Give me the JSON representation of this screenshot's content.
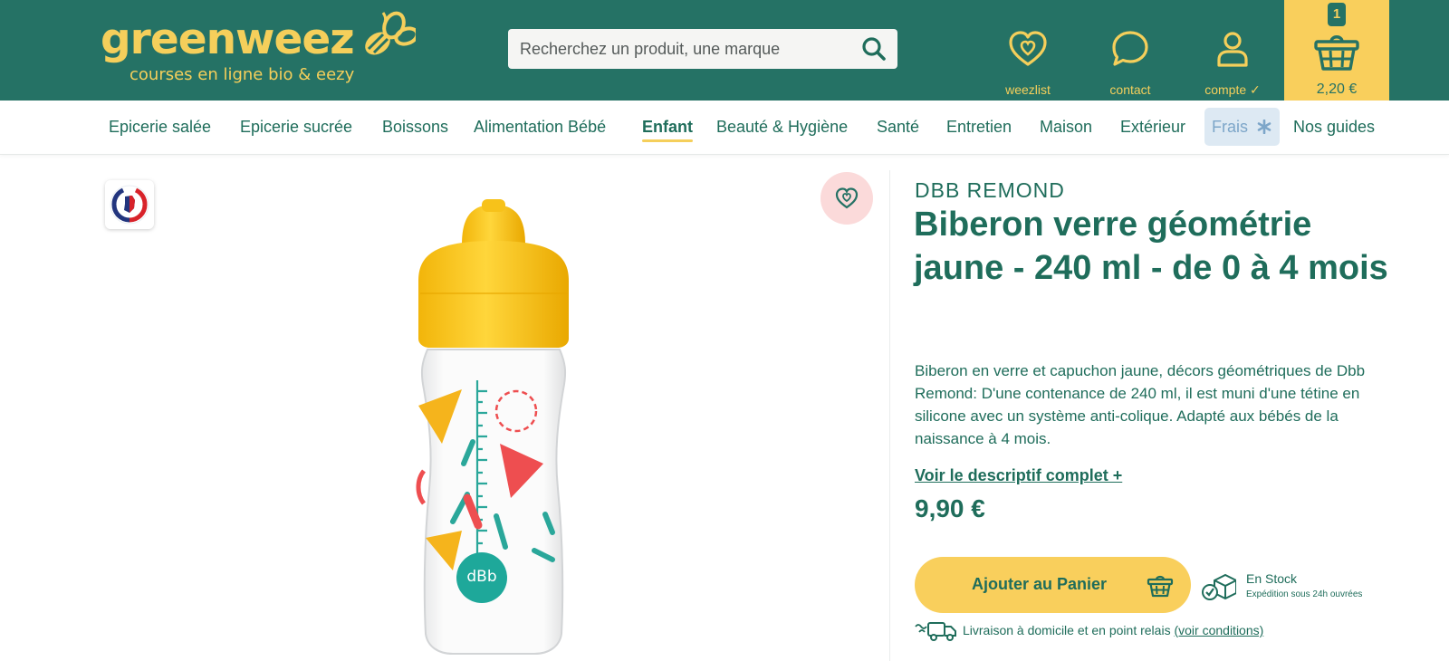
{
  "header": {
    "logo_word": "greenweez",
    "logo_tagline": "courses en ligne bio & eezy",
    "search_placeholder": "Recherchez un produit, une marque",
    "items": [
      {
        "label": "weezlist",
        "icon": "heart-icon"
      },
      {
        "label": "contact",
        "icon": "chat-bubble-icon"
      },
      {
        "label": "compte ✓",
        "icon": "user-icon"
      }
    ],
    "cart": {
      "count": "1",
      "amount": "2,20 €",
      "icon": "basket-icon"
    }
  },
  "nav": {
    "items": [
      "Epicerie salée",
      "Epicerie sucrée",
      "Boissons",
      "Alimentation Bébé",
      "Enfant",
      "Beauté & Hygiène",
      "Santé",
      "Entretien",
      "Maison",
      "Extérieur",
      "Frais",
      "Nos guides"
    ],
    "active": "Enfant"
  },
  "product": {
    "badge": "MADE IN FRANCE",
    "brand": "DBB REMOND",
    "title": "Biberon verre géométrie jaune - 240 ml - de 0 à 4 mois",
    "description": "Biberon en verre et capuchon jaune, décors géométriques de Dbb Remond: D'une contenance de 240 ml, il est muni d'une tétine en silicone avec un système anti-colique. Adapté aux bébés de la naissance à 4 mois.",
    "more_link": "Voir le descriptif complet +",
    "price": "9,90 €",
    "add_to_cart": "Ajouter au Panier",
    "stock": "En Stock",
    "shipping": "Expédition sous 24h ouvrées",
    "delivery": "Livraison à domicile et en point relais",
    "delivery_link": "(voir conditions)"
  },
  "colors": {
    "primary": "#257265",
    "accent": "#f9cf5c",
    "text": "#1f6d5b",
    "frais_bg": "#dde9f3",
    "fav_bg": "#fbdada"
  }
}
